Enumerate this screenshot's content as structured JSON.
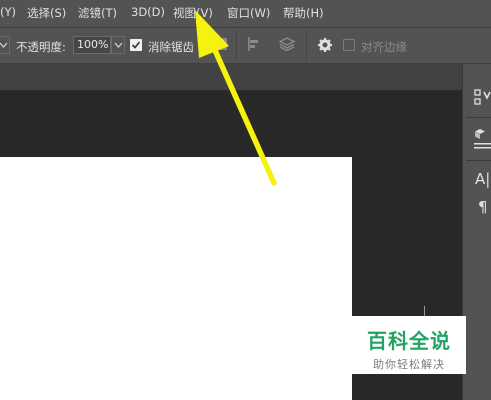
{
  "menu": {
    "items": [
      {
        "label": "(Y)"
      },
      {
        "label": "选择(S)"
      },
      {
        "label": "滤镜(T)"
      },
      {
        "label": "3D(D)"
      },
      {
        "label": "视图(V)"
      },
      {
        "label": "窗口(W)"
      },
      {
        "label": "帮助(H)"
      }
    ]
  },
  "options": {
    "opacity_label": "不透明度:",
    "opacity_value": "100%",
    "antialias_label": "消除锯齿",
    "align_edges_label": "对齐边缘"
  },
  "panel": {
    "text_icon": "A|",
    "paragraph_icon": "¶"
  },
  "watermark": {
    "title": "百科全说",
    "subtitle": "助你轻松解决"
  },
  "colors": {
    "arrow": "#f5f20e",
    "watermark_green": "#23a363"
  }
}
